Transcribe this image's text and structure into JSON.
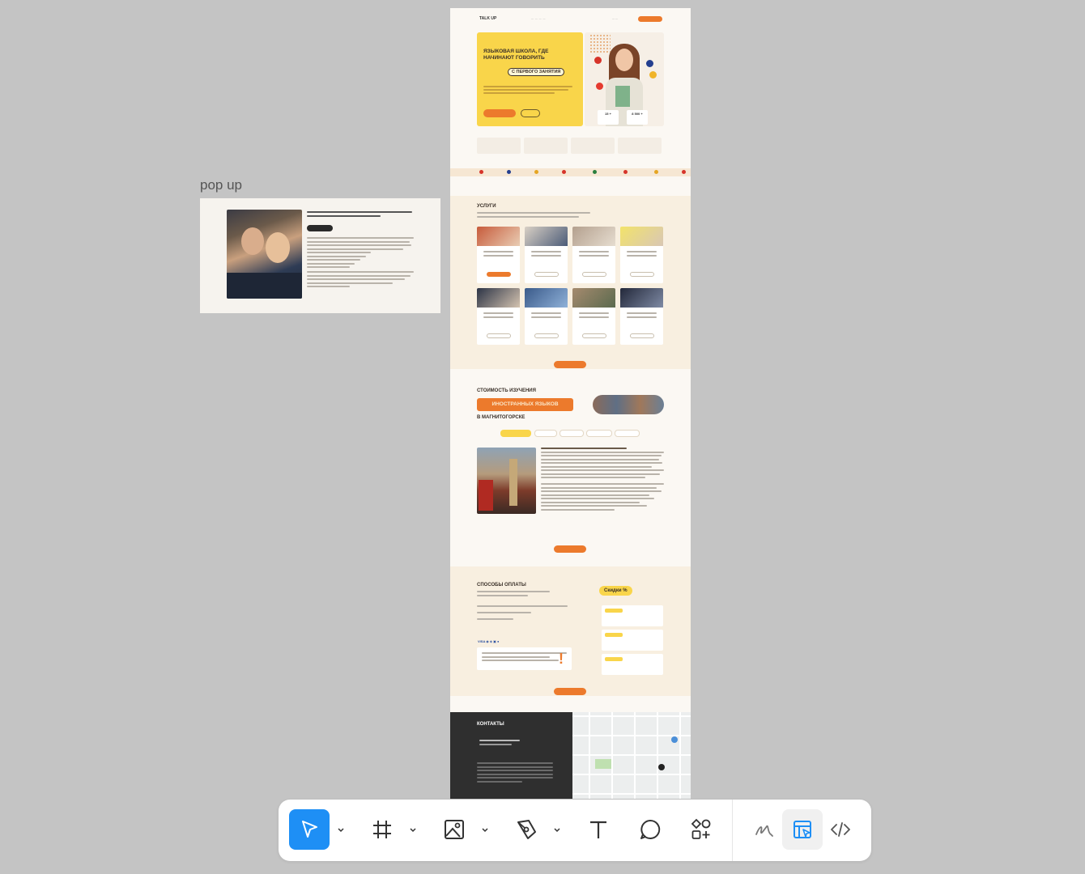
{
  "canvas": {
    "popup_frame_label": "pop up"
  },
  "landing": {
    "hero_title": "Языковая школа, где начинают говорить",
    "hero_pill": "с первого занятия",
    "stat1": "15 +",
    "stat2": "8 500 +",
    "services_title": "Услуги",
    "price_title": "Стоимость изучения",
    "price_highlight": "иностранных языков",
    "price_city": "в Магнитогорске",
    "payment_title": "Способы оплаты",
    "discount_label": "Скидки %",
    "contacts_title": "Контакты"
  },
  "toolbar": {
    "tools": [
      {
        "name": "move-tool",
        "icon": "cursor-icon",
        "active": true,
        "has_caret": true
      },
      {
        "name": "frame-tool",
        "icon": "frame-icon",
        "active": false,
        "has_caret": true
      },
      {
        "name": "image-tool",
        "icon": "image-icon",
        "active": false,
        "has_caret": true
      },
      {
        "name": "pen-tool",
        "icon": "pen-icon",
        "active": false,
        "has_caret": true
      },
      {
        "name": "text-tool",
        "icon": "text-icon",
        "active": false,
        "has_caret": false
      },
      {
        "name": "comment-tool",
        "icon": "comment-icon",
        "active": false,
        "has_caret": false
      },
      {
        "name": "components-tool",
        "icon": "components-icon",
        "active": false,
        "has_caret": false
      }
    ],
    "modes": [
      {
        "name": "draw-mode",
        "icon": "squiggle-icon",
        "selected": false
      },
      {
        "name": "design-mode",
        "icon": "design-mode-icon",
        "selected": true
      },
      {
        "name": "dev-mode",
        "icon": "code-icon",
        "selected": false
      }
    ],
    "accent_color": "#1e8ff5"
  }
}
